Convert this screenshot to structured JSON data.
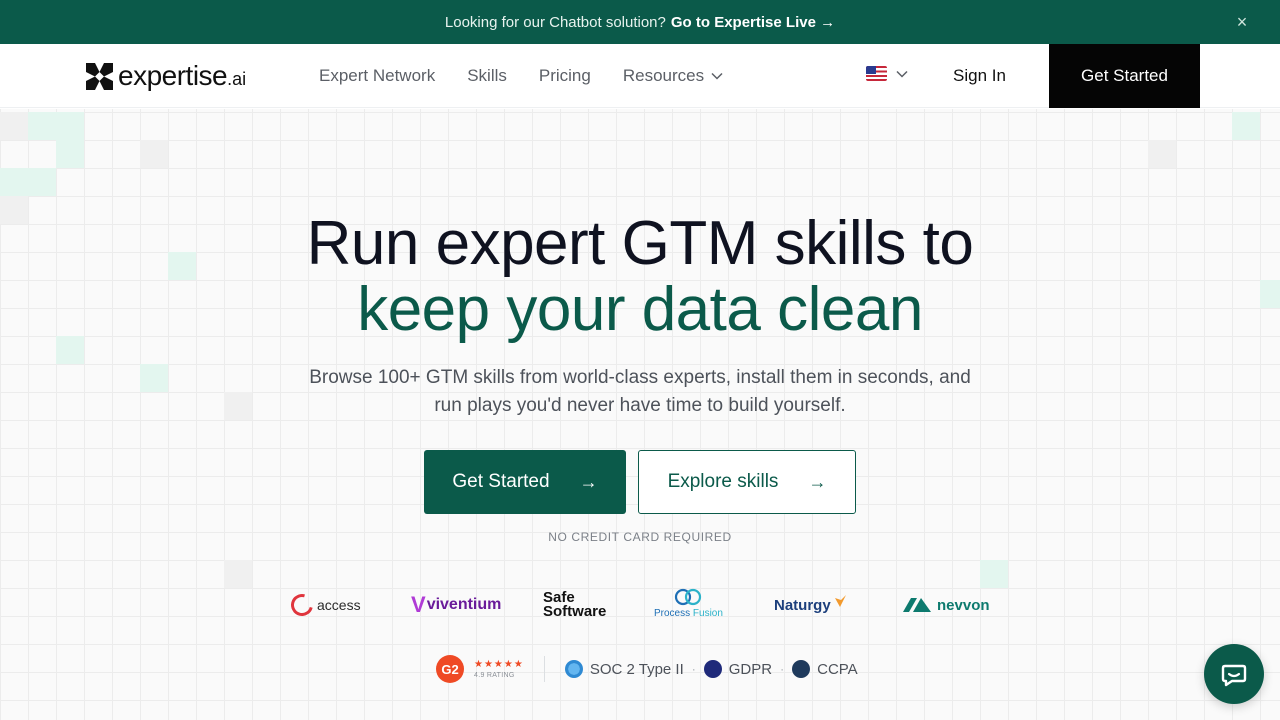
{
  "announcement": {
    "text": "Looking for our Chatbot solution?",
    "link": "Go to Expertise Live →",
    "close_glyph": "×"
  },
  "nav": {
    "logo_word": "expertise",
    "logo_suffix": ".ai",
    "items": [
      {
        "label": "Expert Network"
      },
      {
        "label": "Skills"
      },
      {
        "label": "Pricing"
      },
      {
        "label": "Resources"
      }
    ],
    "signin": "Sign In",
    "cta": "Get Started"
  },
  "hero": {
    "line1": "Run expert GTM skills to",
    "line2": "keep your data clean",
    "sub": "Browse 100+ GTM skills from world-class experts, install them in seconds, and run plays you'd never have time to build yourself.",
    "primary_button": "Get Started",
    "secondary_button": "Explore skills",
    "arrow": "→",
    "note": "NO CREDIT CARD REQUIRED"
  },
  "logos": {
    "access": "access",
    "viventium_v": "V",
    "viventium": "viventium",
    "safe1": "Safe",
    "safe2": "Software",
    "processfusion1": "Process",
    "processfusion2": "Fusion",
    "naturgy": "Naturgy",
    "nevvon": "nevvon"
  },
  "badges": {
    "g2": "G2",
    "stars": "★★★★★",
    "rating": "4.9 RATING",
    "soc2": "SOC 2 Type II",
    "gdpr": "GDPR",
    "ccpa": "CCPA",
    "dot": "·"
  },
  "colors": {
    "brand_green": "#0b5a4a",
    "black": "#050505",
    "mint_tile": "#e3f6ef"
  }
}
